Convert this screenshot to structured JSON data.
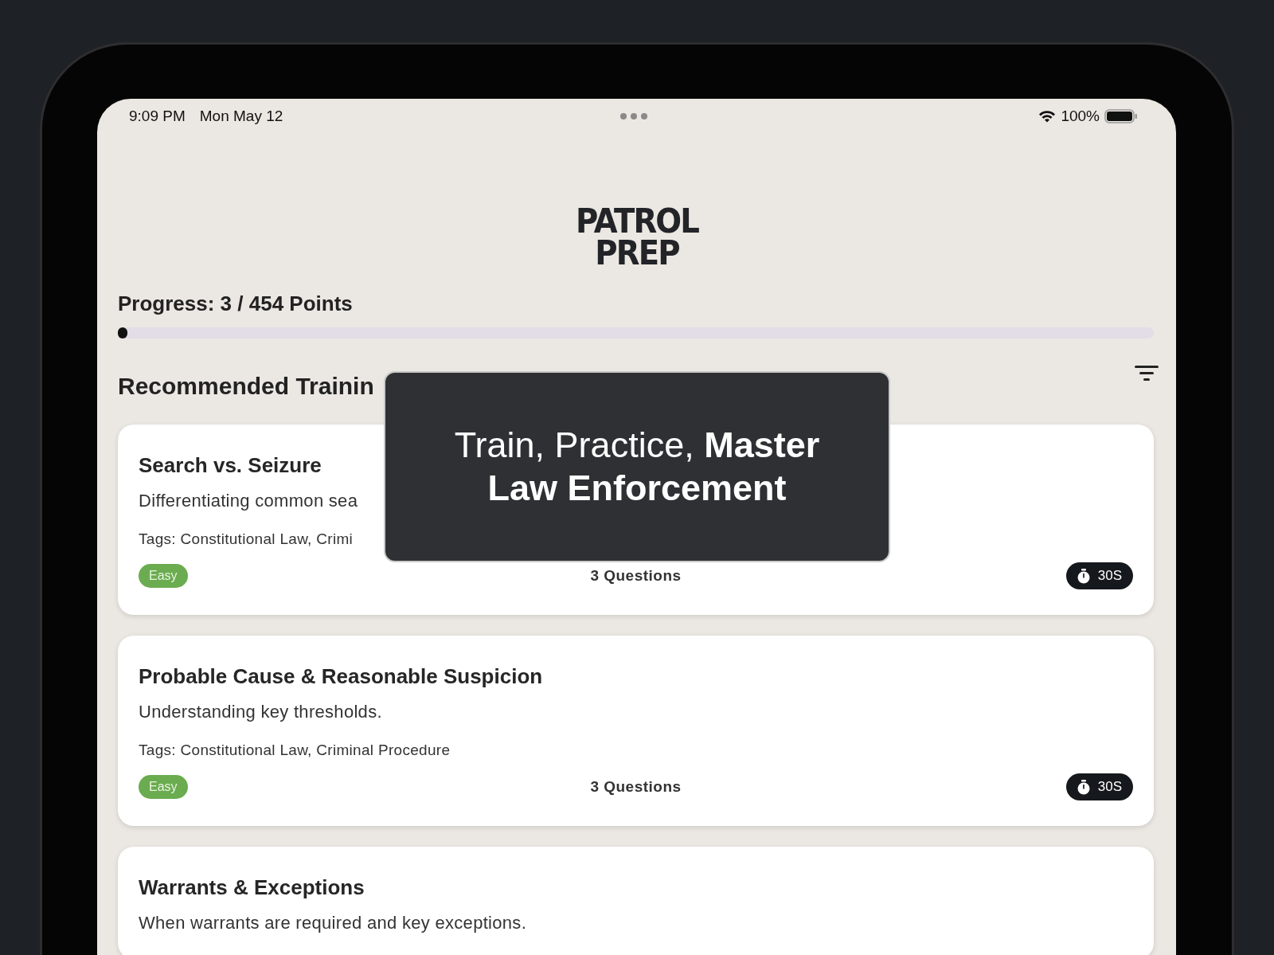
{
  "status_bar": {
    "time": "9:09 PM",
    "date": "Mon May 12",
    "battery": "100%"
  },
  "logo": {
    "line_1": "PATROL",
    "line_2": "PREP"
  },
  "progress": {
    "label": "Progress: 3 / 454 Points",
    "level": 0.0066
  },
  "section": {
    "title": "Recommended Trainin"
  },
  "trainings": [
    {
      "title": "Search vs. Seizure",
      "description": "Differentiating common sea",
      "tags": "Tags: Constitutional Law, Crimi",
      "difficulty": "Easy",
      "questions": "3 Questions",
      "time": "30S"
    },
    {
      "title": "Probable Cause & Reasonable Suspicion",
      "description": "Understanding key thresholds.",
      "tags": "Tags: Constitutional Law, Criminal Procedure",
      "difficulty": "Easy",
      "questions": "3 Questions",
      "time": "30S"
    },
    {
      "title": "Warrants & Exceptions",
      "description": "When warrants are required and key exceptions."
    }
  ],
  "caption": "Train, Practice, **Master Law Enforcement**"
}
